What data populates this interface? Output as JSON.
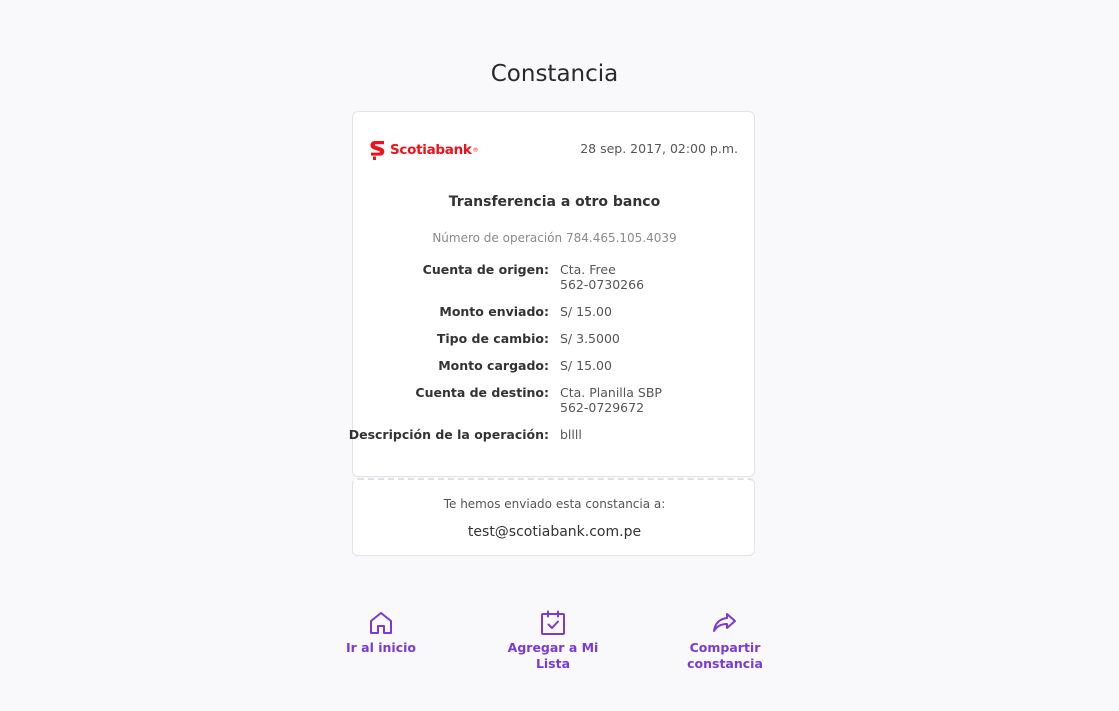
{
  "page": {
    "title": "Constancia"
  },
  "receipt": {
    "brand": "Scotiabank",
    "brand_mark": "®",
    "brand_color": "#ec111a",
    "date": "28 sep. 2017, 02:00 p.m.",
    "operation_title": "Transferencia a otro banco",
    "operation_number_label": "Número de operación",
    "operation_number": "784.465.105.4039",
    "details": [
      {
        "label": "Cuenta de origen:",
        "line1": "Cta. Free",
        "line2": "562-0730266"
      },
      {
        "label": "Monto enviado:",
        "line1": "S/ 15.00",
        "line2": ""
      },
      {
        "label": "Tipo de cambio:",
        "line1": "S/ 3.5000",
        "line2": ""
      },
      {
        "label": "Monto cargado:",
        "line1": "S/ 15.00",
        "line2": ""
      },
      {
        "label": "Cuenta de destino:",
        "line1": "Cta. Planilla SBP",
        "line2": "562-0729672"
      },
      {
        "label": "Descripción de la operación:",
        "line1": "bllll",
        "line2": ""
      }
    ]
  },
  "sent": {
    "label": "Te hemos enviado esta constancia a:",
    "email": "test@scotiabank.com.pe"
  },
  "actions": [
    {
      "icon": "home-icon",
      "label_line1": "Ir al inicio",
      "label_line2": ""
    },
    {
      "icon": "calendar-check-icon",
      "label_line1": "Agregar a Mi",
      "label_line2": "Lista"
    },
    {
      "icon": "share-icon",
      "label_line1": "Compartir",
      "label_line2": "constancia"
    }
  ],
  "colors": {
    "accent": "#7a3ad6",
    "background": "#f9f9fb"
  }
}
